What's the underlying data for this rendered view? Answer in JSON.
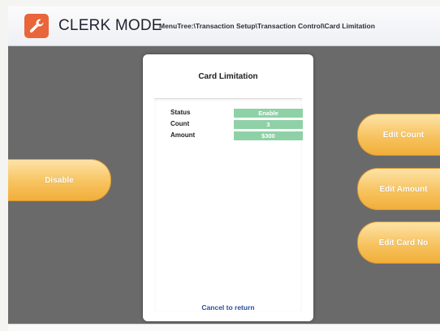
{
  "header": {
    "app_title": "CLERK MODE",
    "breadcrumb": "MenuTree:\\Transaction Setup\\Transaction Control\\Card Limitation",
    "logo_icon": "wrench-icon",
    "logo_color": "#e8663a"
  },
  "panel": {
    "title": "Card Limitation",
    "rows": [
      {
        "label": "Status",
        "value": "Enable"
      },
      {
        "label": "Count",
        "value": "3"
      },
      {
        "label": "Amount",
        "value": "$300"
      }
    ],
    "cancel_label": "Cancel to return",
    "value_color": "#8fd1a6"
  },
  "buttons": {
    "left": {
      "label": "Disable"
    },
    "right": [
      {
        "label": "Edit Count"
      },
      {
        "label": "Edit Amount"
      },
      {
        "label": "Edit Card No"
      }
    ],
    "accent_color": "#f7c35f"
  }
}
